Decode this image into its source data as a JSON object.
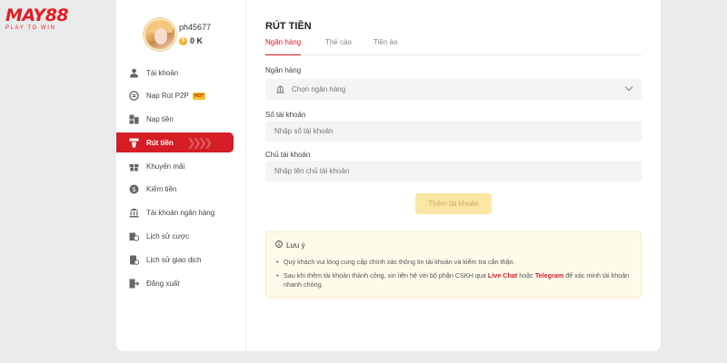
{
  "brand": {
    "name": "MAY88",
    "tagline": "PLAY TO WIN"
  },
  "user": {
    "username": "ph45677",
    "balance": "0 K"
  },
  "sidebar": {
    "items": [
      {
        "label": "Tài khoản",
        "icon": "user-icon"
      },
      {
        "label": "Nạp Rút P2P",
        "icon": "p2p-icon",
        "badge": "HOT"
      },
      {
        "label": "Nạp tiền",
        "icon": "deposit-icon"
      },
      {
        "label": "Rút tiền",
        "icon": "withdraw-icon",
        "active": true
      },
      {
        "label": "Khuyến mãi",
        "icon": "gift-icon"
      },
      {
        "label": "Kiếm tiền",
        "icon": "earn-icon"
      },
      {
        "label": "Tài khoản ngân hàng",
        "icon": "bank-icon"
      },
      {
        "label": "Lịch sử cược",
        "icon": "bet-history-icon"
      },
      {
        "label": "Lịch sử giao dịch",
        "icon": "transaction-history-icon"
      },
      {
        "label": "Đăng xuất",
        "icon": "logout-icon"
      }
    ]
  },
  "main": {
    "title": "RÚT TIỀN",
    "tabs": [
      {
        "label": "Ngân hàng",
        "active": true
      },
      {
        "label": "Thẻ cào"
      },
      {
        "label": "Tiền ảo"
      }
    ],
    "form": {
      "bank_label": "Ngân hàng",
      "bank_placeholder": "Chọn ngân hàng",
      "account_number_label": "Số tài khoản",
      "account_number_placeholder": "Nhập số tài khoản",
      "account_holder_label": "Chủ tài khoản",
      "account_holder_placeholder": "Nhập tên chủ tài khoản",
      "add_button": "Thêm tài khoản"
    },
    "note": {
      "title": "Lưu ý",
      "line1": "Quý khách vui lòng cung cấp chính xác thông tin tài khoản và kiểm tra cẩn thận.",
      "line2_a": "Sau khi thêm tài khoản thành công, xin liên hệ với bộ phận CSKH qua ",
      "line2_live": "Live Chat",
      "line2_or": " hoặc ",
      "line2_tele": "Telegram",
      "line2_b": " để xác minh tài khoản nhanh chóng."
    }
  },
  "colors": {
    "accent": "#d51d25",
    "button_disabled": "#fbe7a3",
    "note_bg": "#fffbea",
    "coin": "#f3b022"
  }
}
